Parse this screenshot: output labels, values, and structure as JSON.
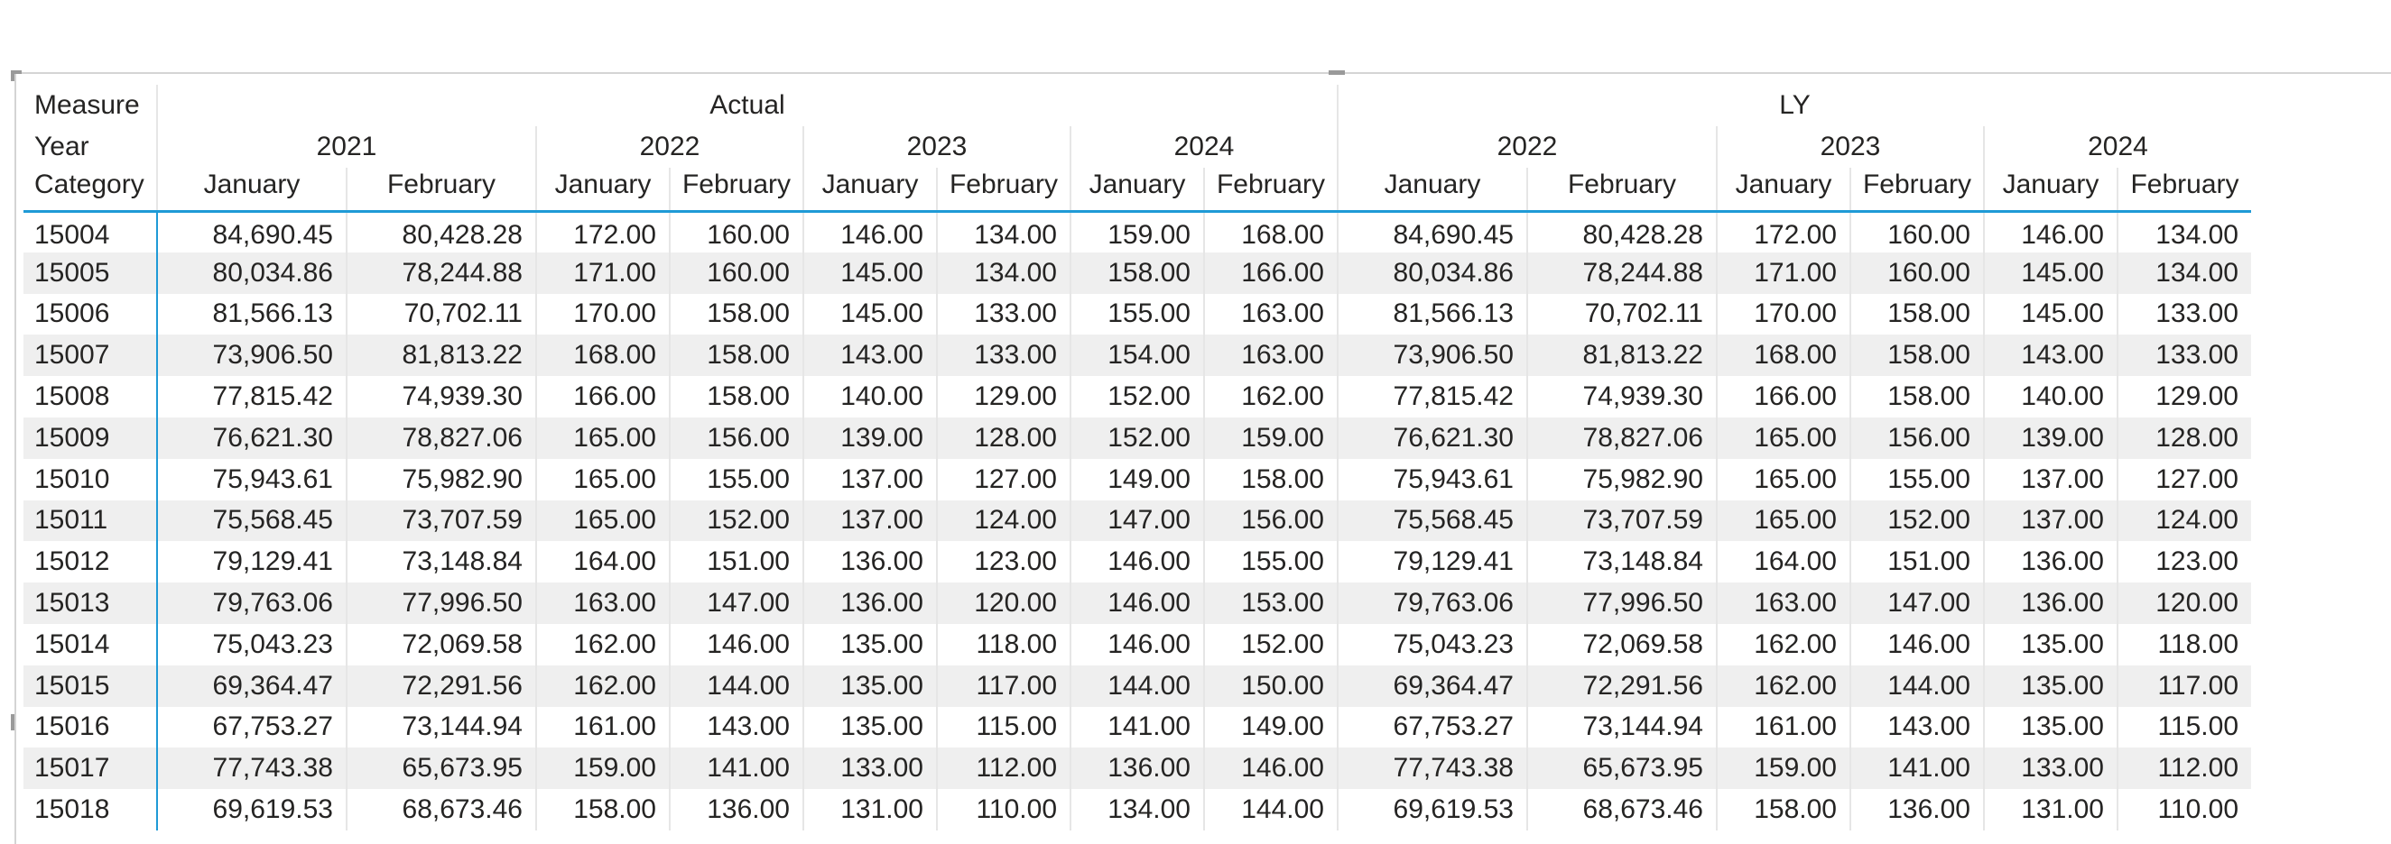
{
  "matrix": {
    "row_headers": {
      "measure": "Measure",
      "year": "Year",
      "category": "Category"
    },
    "measures": [
      {
        "name": "Actual",
        "years": [
          {
            "year": "2021",
            "months": [
              "January",
              "February"
            ]
          },
          {
            "year": "2022",
            "months": [
              "January",
              "February"
            ]
          },
          {
            "year": "2023",
            "months": [
              "January",
              "February"
            ]
          },
          {
            "year": "2024",
            "months": [
              "January",
              "February"
            ]
          }
        ]
      },
      {
        "name": "LY",
        "years": [
          {
            "year": "2022",
            "months": [
              "January",
              "February"
            ]
          },
          {
            "year": "2023",
            "months": [
              "January",
              "February"
            ]
          },
          {
            "year": "2024",
            "months": [
              "January",
              "February"
            ]
          }
        ]
      }
    ],
    "rows": [
      {
        "category": "15004",
        "values": [
          "84,690.45",
          "80,428.28",
          "172.00",
          "160.00",
          "146.00",
          "134.00",
          "159.00",
          "168.00",
          "84,690.45",
          "80,428.28",
          "172.00",
          "160.00",
          "146.00",
          "134.00"
        ]
      },
      {
        "category": "15005",
        "values": [
          "80,034.86",
          "78,244.88",
          "171.00",
          "160.00",
          "145.00",
          "134.00",
          "158.00",
          "166.00",
          "80,034.86",
          "78,244.88",
          "171.00",
          "160.00",
          "145.00",
          "134.00"
        ]
      },
      {
        "category": "15006",
        "values": [
          "81,566.13",
          "70,702.11",
          "170.00",
          "158.00",
          "145.00",
          "133.00",
          "155.00",
          "163.00",
          "81,566.13",
          "70,702.11",
          "170.00",
          "158.00",
          "145.00",
          "133.00"
        ]
      },
      {
        "category": "15007",
        "values": [
          "73,906.50",
          "81,813.22",
          "168.00",
          "158.00",
          "143.00",
          "133.00",
          "154.00",
          "163.00",
          "73,906.50",
          "81,813.22",
          "168.00",
          "158.00",
          "143.00",
          "133.00"
        ]
      },
      {
        "category": "15008",
        "values": [
          "77,815.42",
          "74,939.30",
          "166.00",
          "158.00",
          "140.00",
          "129.00",
          "152.00",
          "162.00",
          "77,815.42",
          "74,939.30",
          "166.00",
          "158.00",
          "140.00",
          "129.00"
        ]
      },
      {
        "category": "15009",
        "values": [
          "76,621.30",
          "78,827.06",
          "165.00",
          "156.00",
          "139.00",
          "128.00",
          "152.00",
          "159.00",
          "76,621.30",
          "78,827.06",
          "165.00",
          "156.00",
          "139.00",
          "128.00"
        ]
      },
      {
        "category": "15010",
        "values": [
          "75,943.61",
          "75,982.90",
          "165.00",
          "155.00",
          "137.00",
          "127.00",
          "149.00",
          "158.00",
          "75,943.61",
          "75,982.90",
          "165.00",
          "155.00",
          "137.00",
          "127.00"
        ]
      },
      {
        "category": "15011",
        "values": [
          "75,568.45",
          "73,707.59",
          "165.00",
          "152.00",
          "137.00",
          "124.00",
          "147.00",
          "156.00",
          "75,568.45",
          "73,707.59",
          "165.00",
          "152.00",
          "137.00",
          "124.00"
        ]
      },
      {
        "category": "15012",
        "values": [
          "79,129.41",
          "73,148.84",
          "164.00",
          "151.00",
          "136.00",
          "123.00",
          "146.00",
          "155.00",
          "79,129.41",
          "73,148.84",
          "164.00",
          "151.00",
          "136.00",
          "123.00"
        ]
      },
      {
        "category": "15013",
        "values": [
          "79,763.06",
          "77,996.50",
          "163.00",
          "147.00",
          "136.00",
          "120.00",
          "146.00",
          "153.00",
          "79,763.06",
          "77,996.50",
          "163.00",
          "147.00",
          "136.00",
          "120.00"
        ]
      },
      {
        "category": "15014",
        "values": [
          "75,043.23",
          "72,069.58",
          "162.00",
          "146.00",
          "135.00",
          "118.00",
          "146.00",
          "152.00",
          "75,043.23",
          "72,069.58",
          "162.00",
          "146.00",
          "135.00",
          "118.00"
        ]
      },
      {
        "category": "15015",
        "values": [
          "69,364.47",
          "72,291.56",
          "162.00",
          "144.00",
          "135.00",
          "117.00",
          "144.00",
          "150.00",
          "69,364.47",
          "72,291.56",
          "162.00",
          "144.00",
          "135.00",
          "117.00"
        ]
      },
      {
        "category": "15016",
        "values": [
          "67,753.27",
          "73,144.94",
          "161.00",
          "143.00",
          "135.00",
          "115.00",
          "141.00",
          "149.00",
          "67,753.27",
          "73,144.94",
          "161.00",
          "143.00",
          "135.00",
          "115.00"
        ]
      },
      {
        "category": "15017",
        "values": [
          "77,743.38",
          "65,673.95",
          "159.00",
          "141.00",
          "133.00",
          "112.00",
          "136.00",
          "146.00",
          "77,743.38",
          "65,673.95",
          "159.00",
          "141.00",
          "133.00",
          "112.00"
        ]
      },
      {
        "category": "15018",
        "values": [
          "69,619.53",
          "68,673.46",
          "158.00",
          "136.00",
          "131.00",
          "110.00",
          "134.00",
          "144.00",
          "69,619.53",
          "68,673.46",
          "158.00",
          "136.00",
          "131.00",
          "110.00"
        ]
      }
    ]
  }
}
